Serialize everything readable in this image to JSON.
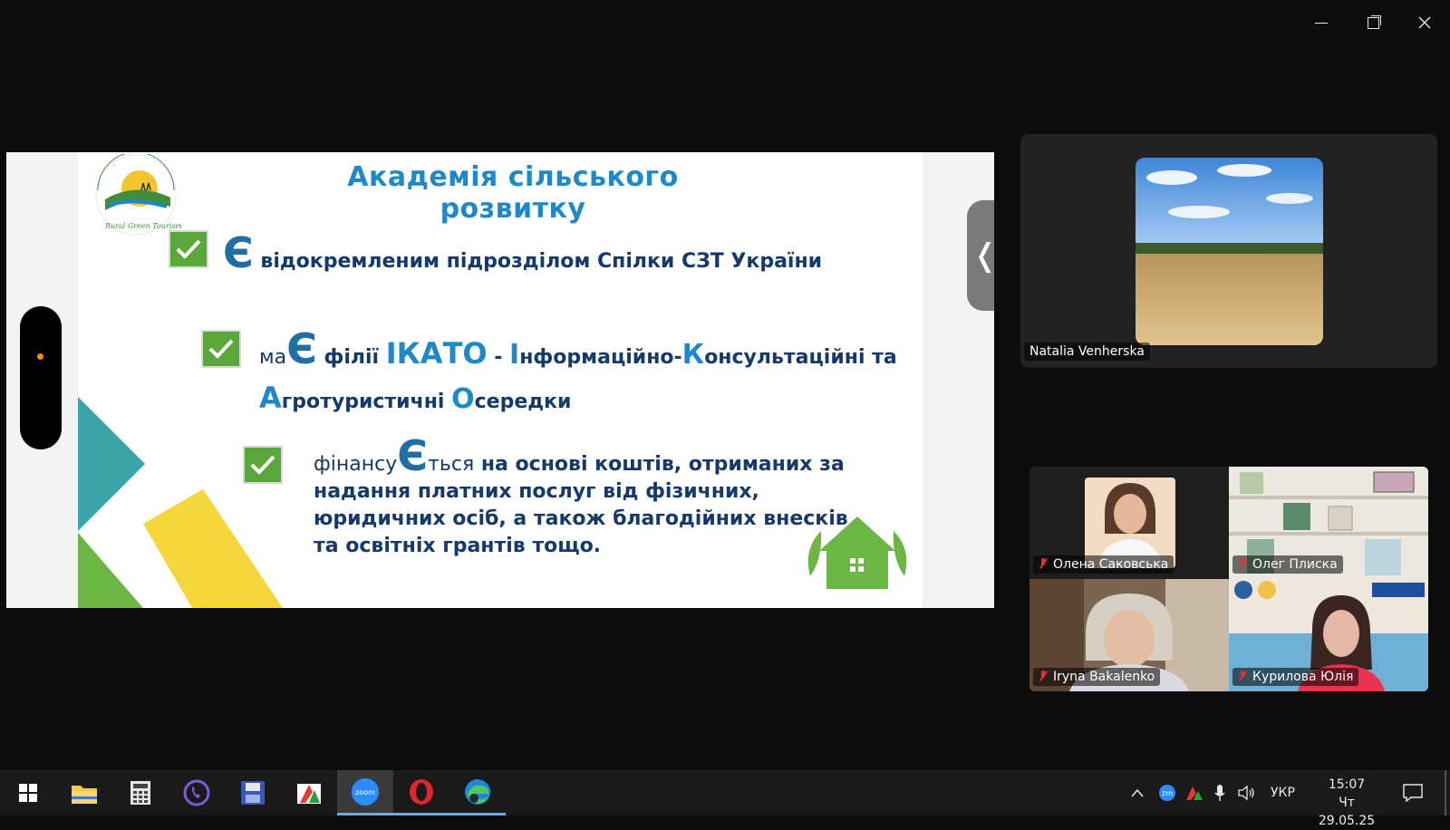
{
  "window": {
    "minimize_icon": "minimize-icon",
    "maximize_icon": "restore-icon",
    "close_icon": "close-icon"
  },
  "slide": {
    "title": "Академія сільського розвитку",
    "logo_text": "Rural Green Tourism in Ukraine",
    "bullet1": {
      "big": "Є",
      "rest": " відокремленим підрозділом Спілки СЗТ України"
    },
    "bullet2": {
      "prefix": "ма",
      "big": "Є",
      "mid": " філії ",
      "acr": "ІКАТО",
      "dash": " - ",
      "i": "І",
      "t1": "нформаційно-",
      "k": "К",
      "t2": "онсультаційні та",
      "a": "А",
      "t3": "гротуристичні ",
      "o": "О",
      "t4": "середки"
    },
    "bullet3": {
      "prefix": "фінансу",
      "big": "Є",
      "suffix": "ться",
      "line1": " на основі коштів, отриманих за",
      "line2": "надання платних послуг від фізичних,",
      "line3": "юридичних осіб, а також благодійних внесків",
      "line4": "та освітніх грантів тощо."
    },
    "collapse_glyph": "❬"
  },
  "speaker": {
    "name": "Natalia Venherska"
  },
  "gallery": [
    {
      "name": "Олена Саковська"
    },
    {
      "name": "Олег Плиска"
    },
    {
      "name": "Iryna Bakalenko"
    },
    {
      "name": "Курилова Юлія"
    }
  ],
  "taskbar": {
    "icons": [
      "windows-start-icon",
      "file-explorer-icon",
      "calculator-icon",
      "viber-icon",
      "save-disk-icon",
      "app-colors-icon",
      "zoom-icon",
      "opera-icon",
      "edge-icon"
    ],
    "zoom_label": "zoom",
    "lang": "УКР",
    "time": "15:07",
    "date": "Чт 29.05.25",
    "colors": {
      "zoom": "#2d8cff",
      "opera": "#e0262b"
    }
  }
}
